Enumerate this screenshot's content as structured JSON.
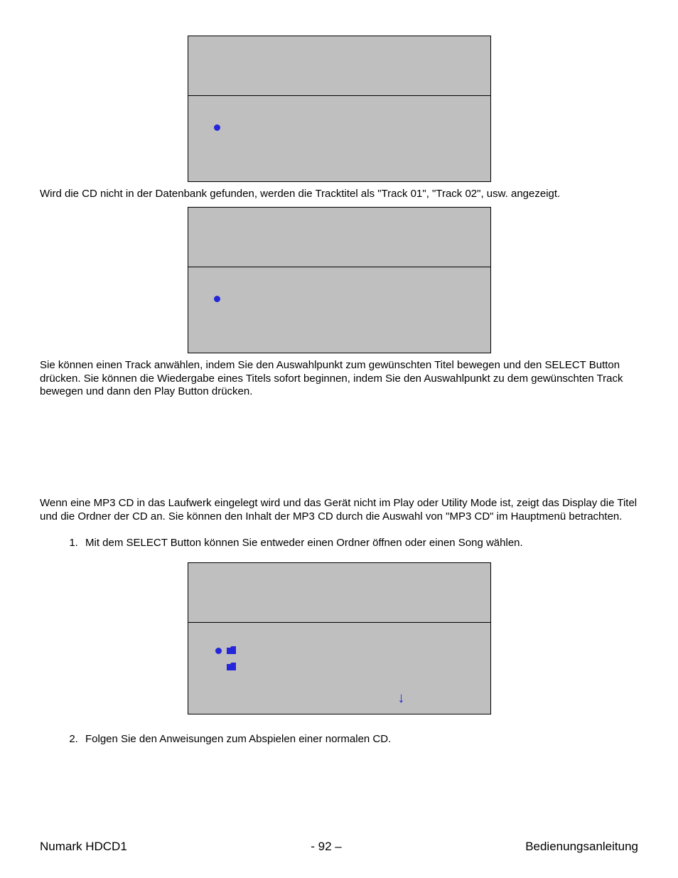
{
  "paragraphs": {
    "p1": "Wird die CD nicht in der Datenbank gefunden, werden die Tracktitel als \"Track 01\", \"Track 02\", usw. angezeigt.",
    "p2": "Sie können einen Track anwählen, indem Sie den Auswahlpunkt zum gewünschten Titel bewegen und den SELECT Button drücken.  Sie können die Wiedergabe eines Titels sofort beginnen, indem Sie den Auswahlpunkt zu dem gewünschten Track bewegen und dann den Play Button drücken.",
    "p3": "Wenn eine MP3 CD in das Laufwerk eingelegt wird und das Gerät nicht im Play oder Utility Mode ist, zeigt das Display die Titel und die Ordner der CD an.  Sie können den Inhalt der MP3 CD durch die Auswahl von \"MP3 CD\" im Hauptmenü betrachten."
  },
  "list": {
    "item1": "Mit dem SELECT Button können Sie entweder einen Ordner öffnen oder einen Song wählen.",
    "item2": "Folgen Sie den Anweisungen zum Abspielen einer normalen CD."
  },
  "footer": {
    "left": "Numark HDCD1",
    "center": "- 92 –",
    "right": "Bedienungsanleitung"
  },
  "icons": {
    "down_arrow": "↓"
  }
}
